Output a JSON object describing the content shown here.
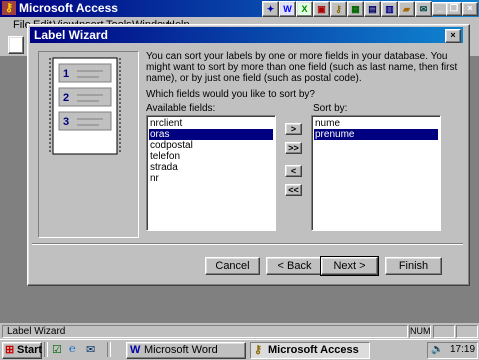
{
  "app": {
    "title": "Microsoft Access",
    "menu": [
      "File",
      "Edit",
      "View",
      "Insert",
      "Tools",
      "Window",
      "Help"
    ],
    "win_controls": [
      "_",
      "²",
      "×"
    ]
  },
  "dialog": {
    "title": "Label Wizard",
    "close": "×",
    "description": "You can sort your labels by one or more fields in your database.  You might want to sort by more than one field (such as last name, then first name), or by just one field (such as postal code).",
    "question": "Which fields would you like to sort by?",
    "available_label": "Available fields:",
    "sortby_label": "Sort by:",
    "available_fields": [
      {
        "name": "nrclient",
        "selected": false
      },
      {
        "name": "oras",
        "selected": true
      },
      {
        "name": "codpostal",
        "selected": false
      },
      {
        "name": "telefon",
        "selected": false
      },
      {
        "name": "strada",
        "selected": false
      },
      {
        "name": "nr",
        "selected": false
      }
    ],
    "sort_fields": [
      {
        "name": "nume",
        "selected": false
      },
      {
        "name": "prenume",
        "selected": true
      }
    ],
    "move_buttons": {
      "add_one": ">",
      "add_all": ">>",
      "remove_one": "<",
      "remove_all": "<<"
    },
    "buttons": {
      "cancel": "Cancel",
      "back": "< Back",
      "next": "Next >",
      "finish": "Finish"
    },
    "illustration_numbers": [
      "1",
      "2",
      "3"
    ]
  },
  "statusbar": {
    "text": "Label Wizard",
    "num": "NUM"
  },
  "taskbar": {
    "start": "Start",
    "tasks": [
      {
        "label": "Microsoft Word",
        "active": false
      },
      {
        "label": "Microsoft Access",
        "active": true
      }
    ],
    "clock": "17:19"
  }
}
